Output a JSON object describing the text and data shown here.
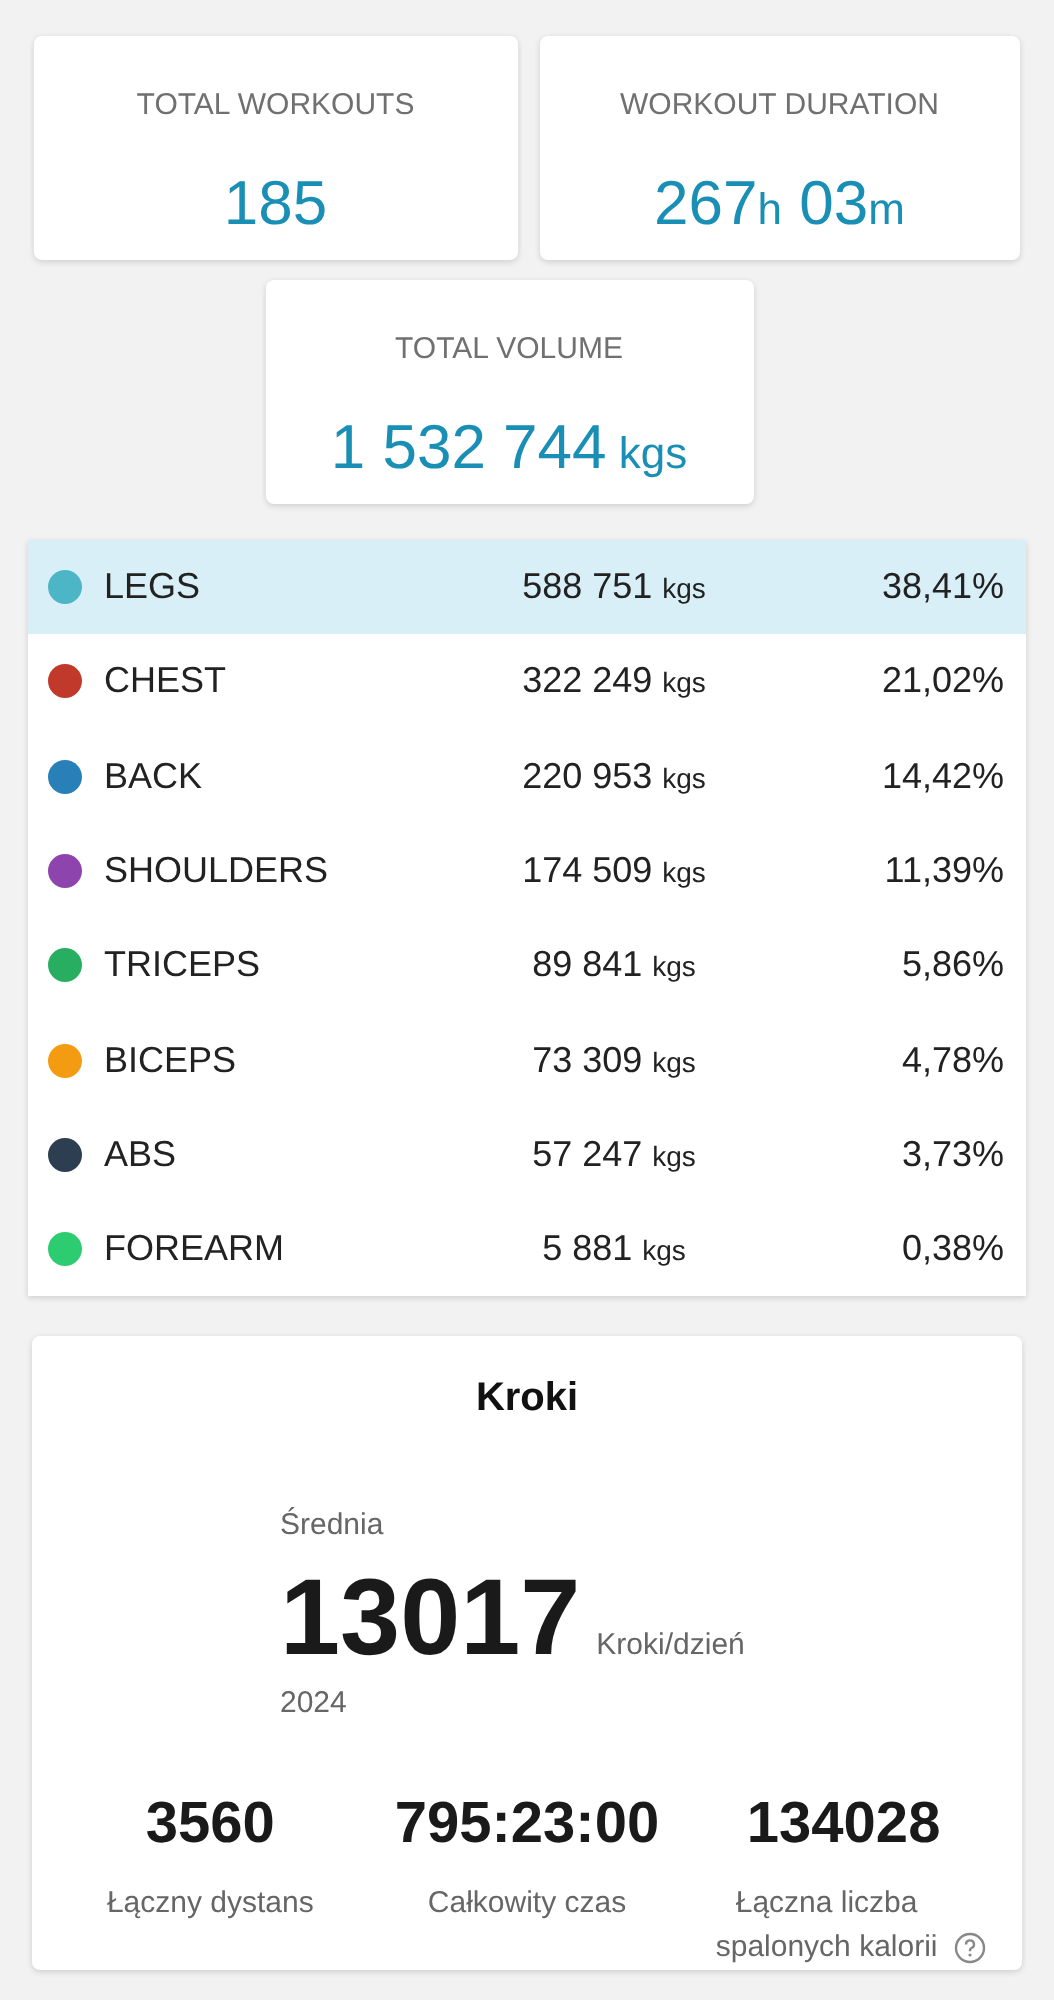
{
  "summary_cards": [
    {
      "label": "TOTAL WORKOUTS",
      "value_parts": [
        {
          "kind": "number",
          "text": "185"
        }
      ]
    },
    {
      "label": "WORKOUT DURATION",
      "value_parts": [
        {
          "kind": "number",
          "text": "267"
        },
        {
          "kind": "unit",
          "text": "h"
        },
        {
          "kind": "number",
          "text": " 03"
        },
        {
          "kind": "unit",
          "text": "m"
        }
      ]
    },
    {
      "label": "TOTAL VOLUME",
      "value_parts": [
        {
          "kind": "number",
          "text": "1 532 744"
        },
        {
          "kind": "unit",
          "text": " kgs"
        }
      ]
    }
  ],
  "muscle_groups": [
    {
      "name": "LEGS",
      "color": "#4db6c6",
      "volume": "588 751",
      "unit": "kgs",
      "percent": "38,41%",
      "selected": true
    },
    {
      "name": "CHEST",
      "color": "#c0392b",
      "volume": "322 249",
      "unit": "kgs",
      "percent": "21,02%",
      "selected": false
    },
    {
      "name": "BACK",
      "color": "#2980b9",
      "volume": "220 953",
      "unit": "kgs",
      "percent": "14,42%",
      "selected": false
    },
    {
      "name": "SHOULDERS",
      "color": "#8e44ad",
      "volume": "174 509",
      "unit": "kgs",
      "percent": "11,39%",
      "selected": false
    },
    {
      "name": "TRICEPS",
      "color": "#27ae60",
      "volume": "89 841",
      "unit": "kgs",
      "percent": "5,86%",
      "selected": false
    },
    {
      "name": "BICEPS",
      "color": "#f39c12",
      "volume": "73 309",
      "unit": "kgs",
      "percent": "4,78%",
      "selected": false
    },
    {
      "name": "ABS",
      "color": "#2c3e50",
      "volume": "57 247",
      "unit": "kgs",
      "percent": "3,73%",
      "selected": false
    },
    {
      "name": "FOREARM",
      "color": "#2ecc71",
      "volume": "5 881",
      "unit": "kgs",
      "percent": "0,38%",
      "selected": false
    }
  ],
  "steps_card": {
    "title": "Kroki",
    "average_label": "Średnia",
    "average_value": "13017",
    "average_unit": "Kroki/dzień",
    "year": "2024",
    "stats": [
      {
        "value": "3560",
        "label": "Łączny dystans",
        "help": false
      },
      {
        "value": "795:23:00",
        "label": "Całkowity czas",
        "help": false
      },
      {
        "value": "134028",
        "label": "Łączna liczba spalonych kalorii",
        "help": true
      }
    ]
  }
}
